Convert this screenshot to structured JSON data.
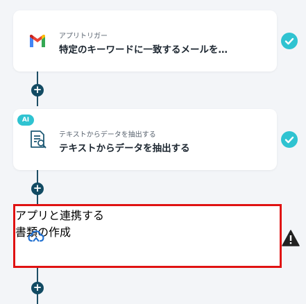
{
  "steps": [
    {
      "category": "アプリトリガー",
      "title": "特定のキーワードに一致するメールを…",
      "icon": "gmail-icon",
      "status": "complete"
    },
    {
      "badge": "AI",
      "category": "テキストからデータを抽出する",
      "title": "テキストからデータを抽出する",
      "icon": "document-search-icon",
      "status": "complete"
    },
    {
      "category": "アプリと連携する",
      "title": "書類の作成",
      "icon": "cloud-link-icon",
      "status": "warning"
    }
  ],
  "colors": {
    "accent": "#2fc3d1",
    "connector": "#124b63",
    "selected_border": "#e01212"
  }
}
